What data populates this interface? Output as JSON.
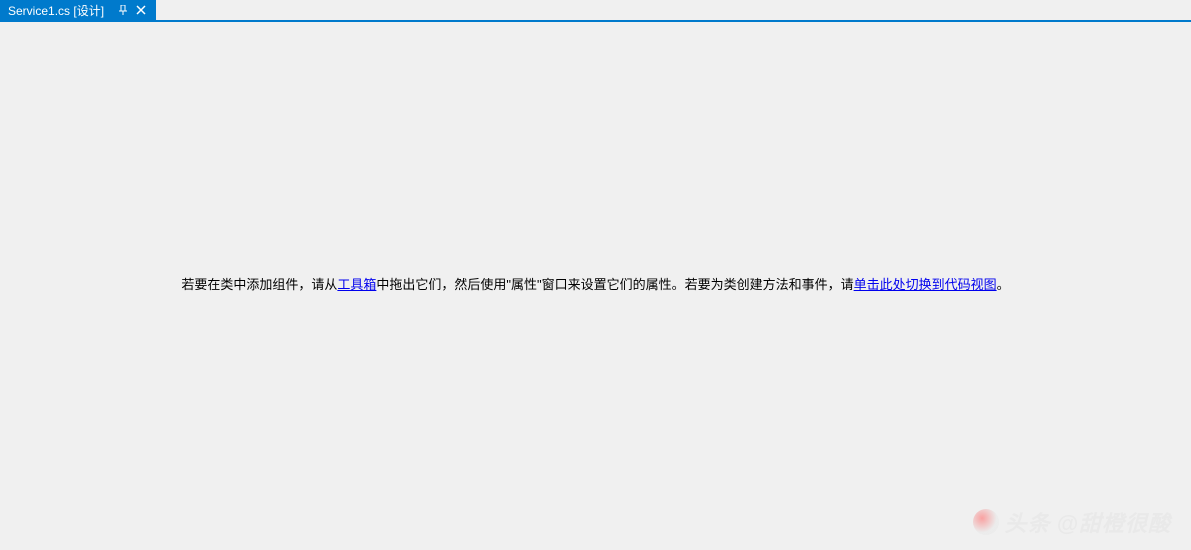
{
  "tab": {
    "label": "Service1.cs [设计]",
    "pin_icon": "⊕",
    "close_icon": "✕"
  },
  "instruction": {
    "part1": "若要在类中添加组件，请从",
    "link1": "工具箱",
    "part2": "中拖出它们，然后使用\"属性\"窗口来设置它们的属性。若要为类创建方法和事件，请",
    "link2": "单击此处切换到代码视图",
    "part3": "。"
  },
  "watermark": {
    "text1": "头条",
    "text2": "@甜橙很酸"
  }
}
